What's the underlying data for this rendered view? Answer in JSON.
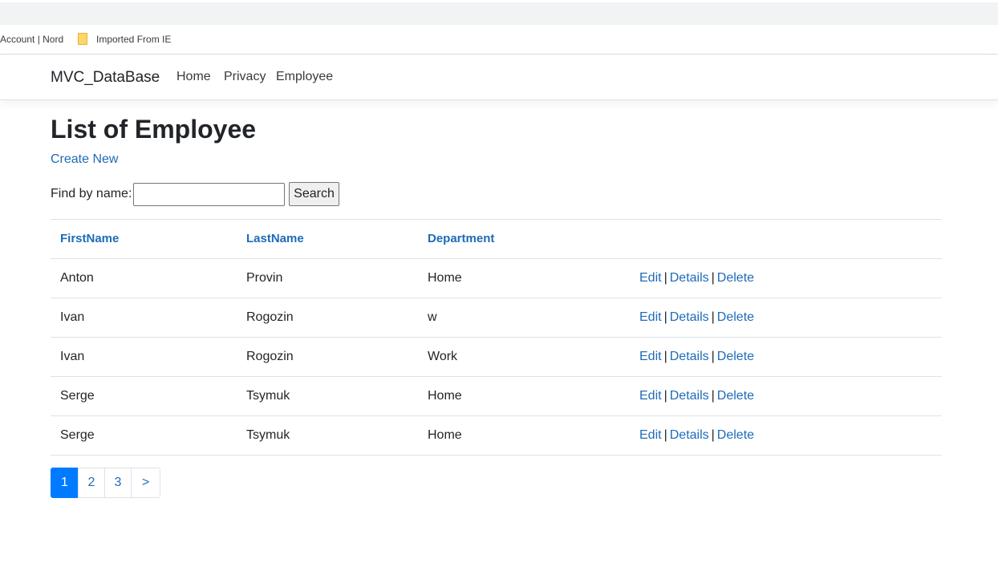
{
  "bookmarks": {
    "account": "Account | Nord",
    "imported": "Imported From IE"
  },
  "navbar": {
    "brand": "MVC_DataBase",
    "links": [
      "Home",
      "Privacy",
      "Employee"
    ]
  },
  "page": {
    "title": "List of Employee",
    "create_link": "Create New"
  },
  "search": {
    "label": "Find by name:",
    "value": "",
    "button": "Search"
  },
  "table": {
    "headers": [
      "FirstName",
      "LastName",
      "Department"
    ],
    "rows": [
      [
        "Anton",
        "Provin",
        "Home"
      ],
      [
        "Ivan",
        "Rogozin",
        "w"
      ],
      [
        "Ivan",
        "Rogozin",
        "Work"
      ],
      [
        "Serge",
        "Tsymuk",
        "Home"
      ],
      [
        "Serge",
        "Tsymuk",
        "Home"
      ]
    ],
    "actions": {
      "edit": "Edit",
      "details": "Details",
      "delete": "Delete",
      "separator": "|"
    }
  },
  "pagination": {
    "pages": [
      "1",
      "2",
      "3",
      ">"
    ],
    "active": "1"
  },
  "colors": {
    "link": "#1e6bb8",
    "active_page": "#007bff"
  }
}
